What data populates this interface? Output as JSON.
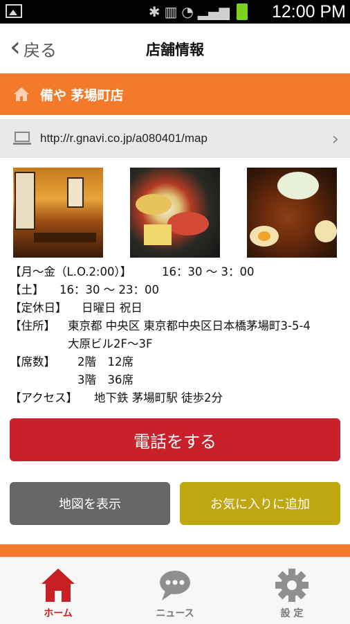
{
  "status_bar": {
    "time": "12:00 PM"
  },
  "header": {
    "back_label": "戻る",
    "title": "店舗情報"
  },
  "shop": {
    "name": "備や 茅場町店"
  },
  "url": {
    "text": "http://r.gnavi.co.jp/a080401/map"
  },
  "photos": [
    {
      "name": "interior-photo"
    },
    {
      "name": "course-dishes-photo"
    },
    {
      "name": "braised-pork-photo"
    }
  ],
  "info": {
    "weekday": {
      "label": "【月～金（L.O.2:00）】",
      "value": "16：30 ～ 3：00"
    },
    "saturday": {
      "label": "【土】",
      "value": "16：30 ～ 23：00"
    },
    "holiday": {
      "label": "【定休日】",
      "value": "日曜日 祝日"
    },
    "address": {
      "label": "【住所】",
      "line1": "東京都 中央区 東京都中央区日本橋茅場町3-5-4",
      "line2": "大原ビル2F～3F"
    },
    "seats": {
      "label": "【席数】",
      "line1": "2階　12席",
      "line2": "3階　36席"
    },
    "access": {
      "label": "【アクセス】",
      "value": "地下鉄 茅場町駅 徒歩2分"
    }
  },
  "buttons": {
    "call": "電話をする",
    "map": "地図を表示",
    "favorite": "お気に入りに追加"
  },
  "tabs": [
    {
      "label": "ホーム",
      "icon": "home-icon"
    },
    {
      "label": "ニュース",
      "icon": "chat-bubble-icon"
    },
    {
      "label": "設 定",
      "icon": "gear-icon"
    }
  ],
  "colors": {
    "accent_orange": "#f47a2b",
    "call_red": "#c9212b",
    "map_gray": "#676767",
    "favorite_olive": "#bfa712",
    "tab_active": "#c62026"
  }
}
